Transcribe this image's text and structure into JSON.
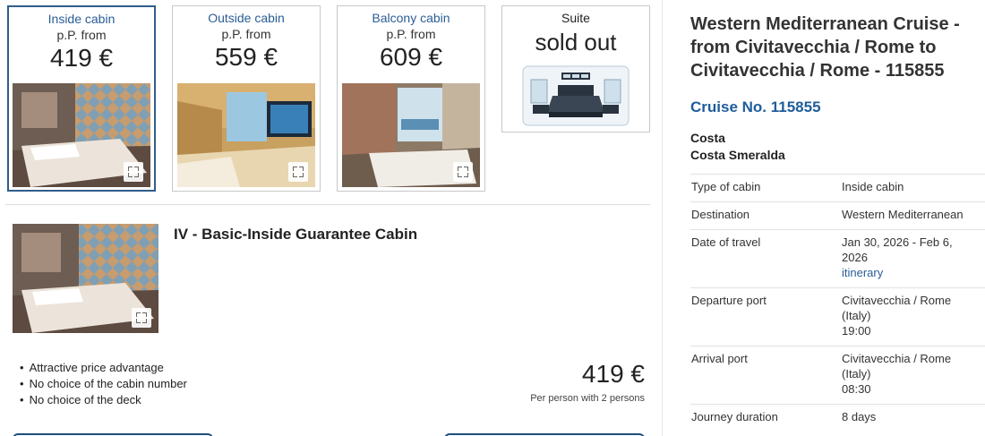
{
  "cabins": [
    {
      "type": "Inside cabin",
      "from": "p.P. from",
      "price": "419 €",
      "selected": true
    },
    {
      "type": "Outside cabin",
      "from": "p.P. from",
      "price": "559 €"
    },
    {
      "type": "Balcony cabin",
      "from": "p.P. from",
      "price": "609 €"
    },
    {
      "type": "Suite",
      "status": "sold out"
    }
  ],
  "detail": {
    "title": "IV - Basic-Inside Guarantee Cabin",
    "features": [
      "Attractive price advantage",
      "No choice of the cabin number",
      "No choice of the deck"
    ],
    "price": "419 €",
    "price_note": "Per person with 2 persons"
  },
  "info": {
    "title": "Western Mediterranean Cruise - from Civitavecchia / Rome to Civitavecchia / Rome - 115855",
    "cruise_no": "Cruise No. 115855",
    "line": "Costa",
    "ship": "Costa Smeralda",
    "rows": {
      "cabin_type": {
        "label": "Type of cabin",
        "value": "Inside cabin"
      },
      "destination": {
        "label": "Destination",
        "value": "Western Mediterranean"
      },
      "date": {
        "label": "Date of travel",
        "value_line1": "Jan 30, 2026 - Feb 6,",
        "value_line2": "2026",
        "link": "itinerary"
      },
      "departure": {
        "label": "Departure port",
        "value_line1": "Civitavecchia / Rome",
        "value_line2": "(Italy)",
        "time": "19:00"
      },
      "arrival": {
        "label": "Arrival port",
        "value_line1": "Civitavecchia / Rome",
        "value_line2": "(Italy)",
        "time": "08:30"
      },
      "duration": {
        "label": "Journey duration",
        "value": "8 days"
      }
    }
  }
}
